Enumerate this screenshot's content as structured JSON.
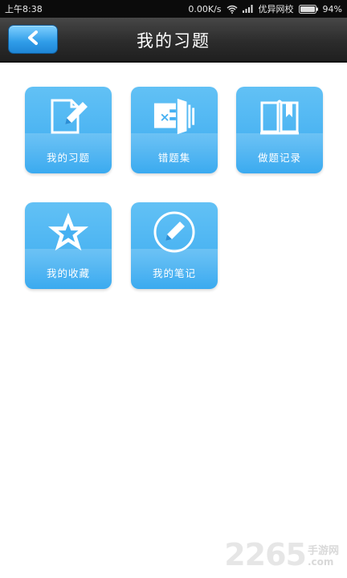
{
  "status_bar": {
    "time": "上午8:38",
    "speed": "0.00K/s",
    "carrier": "优异网校",
    "battery": "94%"
  },
  "header": {
    "title": "我的习题",
    "back_icon": "chevron-left-icon"
  },
  "tiles": [
    {
      "label": "我的习题",
      "icon": "edit-document-icon"
    },
    {
      "label": "错题集",
      "icon": "wrong-questions-icon"
    },
    {
      "label": "做题记录",
      "icon": "open-book-icon"
    },
    {
      "label": "我的收藏",
      "icon": "star-icon"
    },
    {
      "label": "我的笔记",
      "icon": "pencil-circle-icon"
    }
  ],
  "watermark": {
    "number": "2265",
    "text": "手游网",
    "domain": ".com"
  },
  "colors": {
    "tile": "#45b0f2",
    "title_bar": "#2e2e2e",
    "back_button": "#2f9ce8"
  }
}
